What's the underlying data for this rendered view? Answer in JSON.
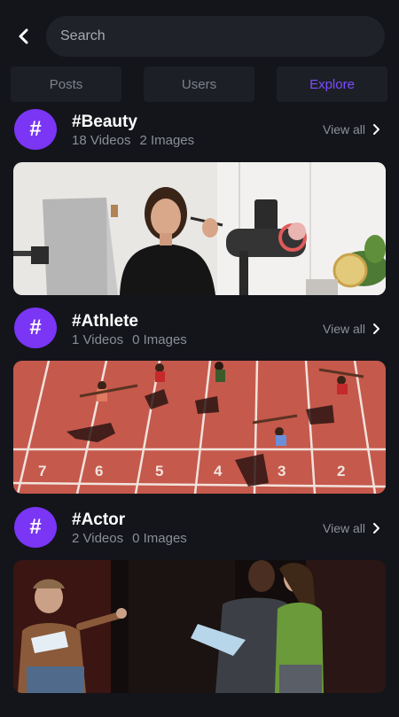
{
  "search": {
    "placeholder": "Search"
  },
  "tabs": [
    {
      "label": "Posts"
    },
    {
      "label": "Users"
    },
    {
      "label": "Explore",
      "active": true
    }
  ],
  "hashtags": [
    {
      "symbol": "#",
      "title": "#Beauty",
      "videos": "18 Videos",
      "images": "2 Images",
      "view_all": "View all"
    },
    {
      "symbol": "#",
      "title": "#Athlete",
      "videos": "1 Videos",
      "images": "0 Images",
      "view_all": "View all"
    },
    {
      "symbol": "#",
      "title": "#Actor",
      "videos": "2 Videos",
      "images": "0 Images",
      "view_all": "View all"
    }
  ],
  "track_lane_numbers": [
    "7",
    "6",
    "5",
    "4",
    "3",
    "2"
  ],
  "colors": {
    "accent": "#7b4dff",
    "badge": "#7a35f5",
    "background": "#13151b"
  }
}
